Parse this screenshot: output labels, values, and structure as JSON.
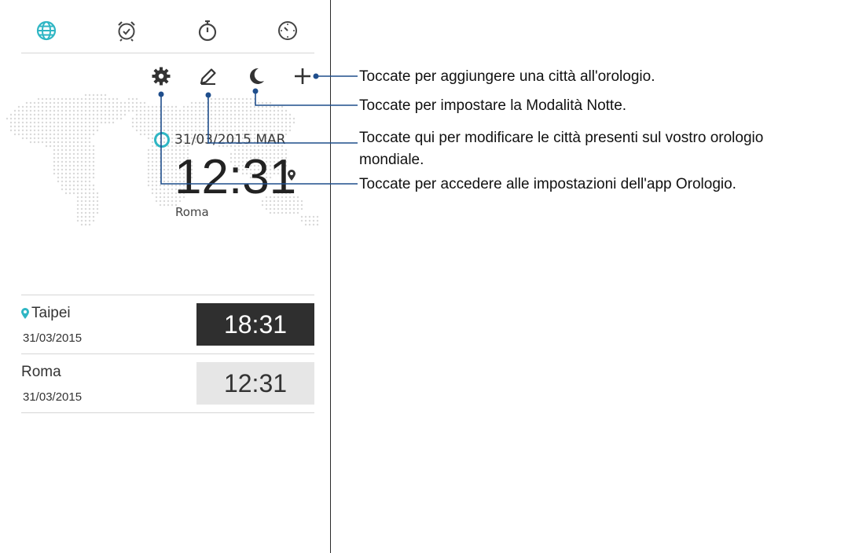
{
  "tabs": [
    {
      "name": "world-clock",
      "icon": "globe-icon",
      "active": true
    },
    {
      "name": "alarm",
      "icon": "alarm-clock-icon",
      "active": false
    },
    {
      "name": "stopwatch",
      "icon": "stopwatch-icon",
      "active": false
    },
    {
      "name": "timer",
      "icon": "timer-icon",
      "active": false
    }
  ],
  "actions": [
    "gear-icon",
    "pencil-icon",
    "moon-icon",
    "plus-icon"
  ],
  "main_clock": {
    "date": "31/03/2015 MAR",
    "time": "12:31",
    "city": "Roma"
  },
  "cities": [
    {
      "city": "Taipei",
      "date": "31/03/2015",
      "time": "18:31",
      "current": true
    },
    {
      "city": "Roma",
      "date": "31/03/2015",
      "time": "12:31",
      "current": false
    }
  ],
  "callouts": {
    "add_city": "Toccate per aggiungere una città all'orologio.",
    "night_mode": "Toccate per impostare la Modalità Notte.",
    "edit_cities_line1": "Toccate qui per modificare le città presenti sul vostro orologio",
    "edit_cities_line2": "mondiale.",
    "settings": "Toccate per accedere alle impostazioni dell'app Orologio."
  },
  "colors": {
    "accent": "#2fb6c4",
    "callout_line": "#1f4e8c"
  }
}
